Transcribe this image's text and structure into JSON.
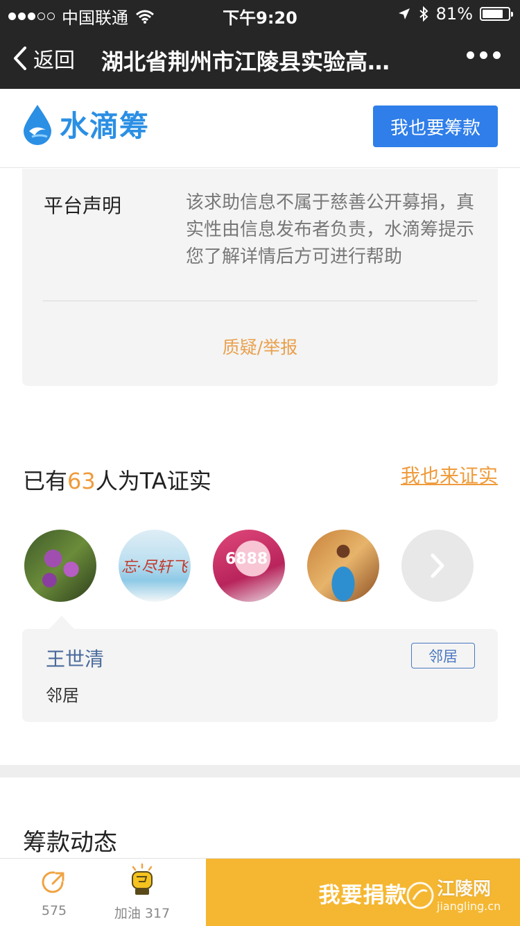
{
  "status_bar": {
    "carrier": "中国联通",
    "time": "下午9:20",
    "battery": "81%",
    "battery_level": 0.81
  },
  "nav": {
    "back_label": "返回",
    "title": "湖北省荆州市江陵县实验高…"
  },
  "header": {
    "brand": "水滴筹",
    "fund_button": "我也要筹款"
  },
  "declaration": {
    "label": "平台声明",
    "text": "该求助信息不属于慈善公开募捐，真实性由信息发布者负责，水滴筹提示您了解详情后方可进行帮助",
    "report_link": "质疑/举报"
  },
  "verification": {
    "prefix": "已有",
    "count": "63",
    "suffix": "人为TA证实",
    "link": "我也来证实",
    "avatars": [
      {
        "name": "avatar-flowers"
      },
      {
        "name": "avatar-calligraphy"
      },
      {
        "name": "avatar-promo"
      },
      {
        "name": "avatar-portrait"
      }
    ],
    "comment": {
      "name": "王世清",
      "tag": "邻居",
      "text": "邻居"
    }
  },
  "progress": {
    "title": "筹款动态"
  },
  "bottom_bar": {
    "share_count": "575",
    "cheer_label": "加油 317",
    "donate_label": "我要捐款"
  },
  "watermark": {
    "name": "江陵网",
    "url": "jiangling.cn"
  },
  "colors": {
    "accent_blue": "#2f7ee9",
    "accent_orange": "#ef9b3b",
    "donate_yellow": "#f5b731",
    "nav_dark": "#262626"
  }
}
